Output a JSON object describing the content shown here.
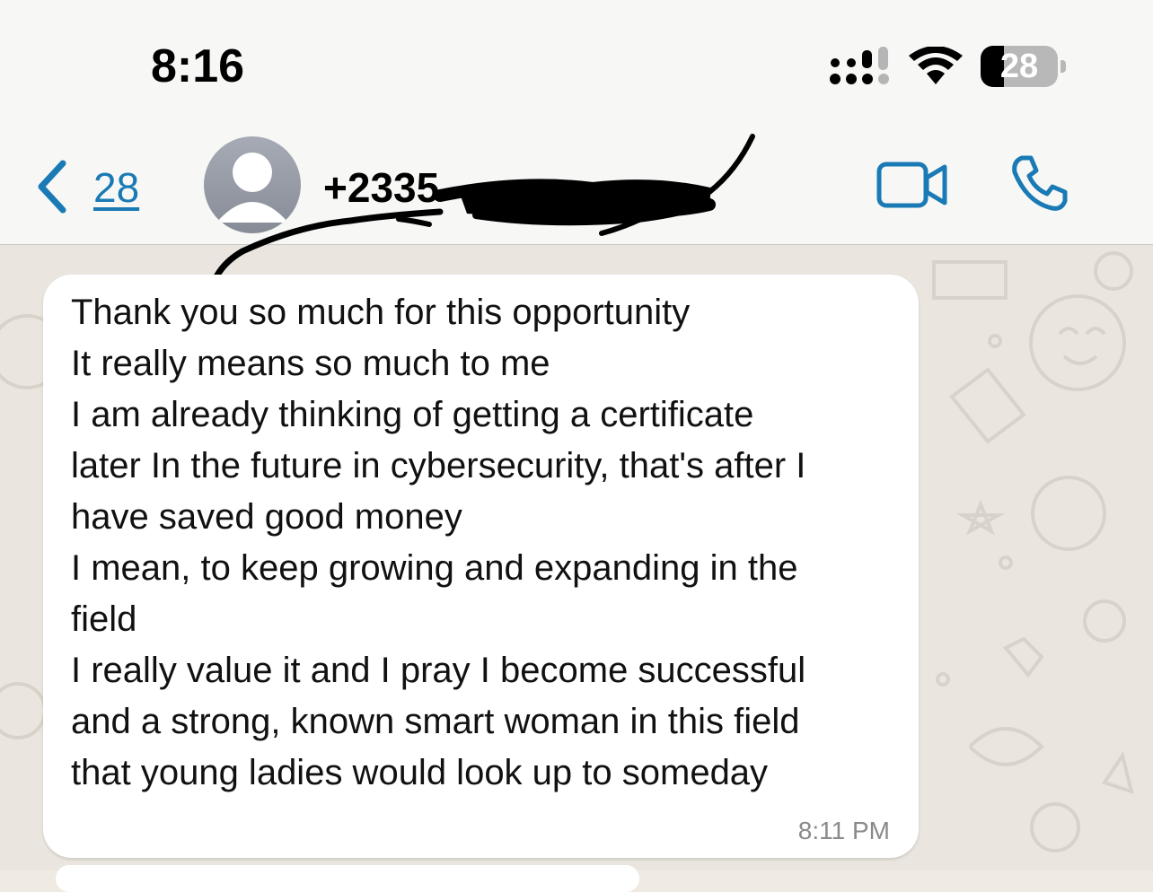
{
  "status_bar": {
    "time": "8:16",
    "battery_level": "28",
    "icons": [
      "cellular-signal-icon",
      "wifi-icon",
      "battery-icon"
    ]
  },
  "header": {
    "back_count": "28",
    "contact_name": "+2335",
    "icons": [
      "chevron-left-icon",
      "avatar-icon",
      "video-call-icon",
      "phone-icon"
    ],
    "accent_color": "#1a7ab5"
  },
  "messages": [
    {
      "lines": [
        "Thank you so much for this opportunity",
        "It really means so much to me",
        "I am already thinking of getting a certificate",
        "later In the future in cybersecurity, that's after I",
        "have saved good money",
        "I mean, to keep growing and expanding in the",
        "field",
        "I really value it and I pray I become successful",
        "and a strong, known smart woman in this field",
        "that young ladies would look up to someday"
      ],
      "timestamp": "8:11 PM"
    }
  ]
}
